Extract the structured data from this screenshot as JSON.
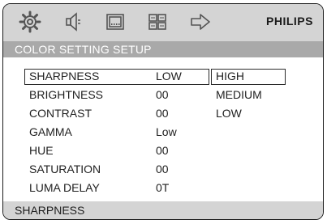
{
  "toolbar": {
    "icons": [
      "gear-icon",
      "speaker-icon",
      "screen-icon",
      "grid-icon",
      "exit-arrow-icon"
    ],
    "brand": "PHILIPS"
  },
  "header": {
    "title": "COLOR SETTING SETUP"
  },
  "menu": {
    "items": [
      {
        "label": "SHARPNESS",
        "value": "LOW"
      },
      {
        "label": "BRIGHTNESS",
        "value": "00"
      },
      {
        "label": "CONTRAST",
        "value": "00"
      },
      {
        "label": "GAMMA",
        "value": "Low"
      },
      {
        "label": "HUE",
        "value": "00"
      },
      {
        "label": "SATURATION",
        "value": "00"
      },
      {
        "label": "LUMA DELAY",
        "value": "0T"
      }
    ],
    "selected_index": 0
  },
  "options": {
    "items": [
      "HIGH",
      "MEDIUM",
      "LOW"
    ],
    "selected_index": 0
  },
  "status": {
    "text": "SHARPNESS"
  },
  "colors": {
    "toolbar_bg": "#d4d4d4",
    "header_bg": "#a9a9a9",
    "header_text": "#ffffff",
    "text": "#1f1f1f"
  }
}
